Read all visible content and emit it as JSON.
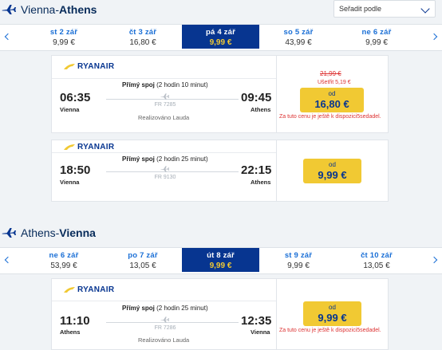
{
  "outbound": {
    "from": "Vienna",
    "separator": " - ",
    "to": "Athens",
    "sort_label": "Seřadit podle",
    "days": [
      {
        "date": "st 2 zář",
        "price": "9,99 €"
      },
      {
        "date": "čt 3 zář",
        "price": "16,80 €"
      },
      {
        "date": "pá 4 zář",
        "price": "9,99 €",
        "selected": true
      },
      {
        "date": "so 5 zář",
        "price": "43,99 €"
      },
      {
        "date": "ne 6 zář",
        "price": "9,99 €"
      }
    ],
    "flights": [
      {
        "airline": "RYANAIR",
        "depart_time": "06:35",
        "depart_city": "Vienna",
        "arrive_time": "09:45",
        "arrive_city": "Athens",
        "direct": "Přímý spoj",
        "duration": "(2 hodin 10 minut)",
        "flight_no": "FR 7285",
        "operated": "Realizováno Lauda",
        "old_price": "21,99 €",
        "saving": "Ušetřit 5,19 €",
        "from_label": "od",
        "price": "16,80 €",
        "seat_note": "Za tuto cenu je ještě k dispozici5sedadel."
      },
      {
        "airline": "RYANAIR",
        "depart_time": "18:50",
        "depart_city": "Vienna",
        "arrive_time": "22:15",
        "arrive_city": "Athens",
        "direct": "Přímý spoj",
        "duration": "(2 hodin 25 minut)",
        "flight_no": "FR 9130",
        "from_label": "od",
        "price": "9,99 €"
      }
    ]
  },
  "return": {
    "from": "Athens",
    "separator": " - ",
    "to": "Vienna",
    "days": [
      {
        "date": "ne 6 zář",
        "price": "53,99 €"
      },
      {
        "date": "po 7 zář",
        "price": "13,05 €"
      },
      {
        "date": "út 8 zář",
        "price": "9,99 €",
        "selected": true
      },
      {
        "date": "st 9 zář",
        "price": "9,99 €"
      },
      {
        "date": "čt 10 zář",
        "price": "13,05 €"
      }
    ],
    "flights": [
      {
        "airline": "RYANAIR",
        "depart_time": "11:10",
        "depart_city": "Athens",
        "arrive_time": "12:35",
        "arrive_city": "Vienna",
        "direct": "Přímý spoj",
        "duration": "(2 hodin 25 minut)",
        "flight_no": "FR 7286",
        "operated": "Realizováno Lauda",
        "from_label": "od",
        "price": "9,99 €",
        "seat_note": "Za tuto cenu je ještě k dispozici5sedadel."
      }
    ]
  },
  "colors": {
    "navy": "#073590",
    "yellow": "#f1c933",
    "link_blue": "#1a6fd6",
    "alert_red": "#dd3333"
  },
  "icons": [
    "plane-icon",
    "ryanair-harp-icon",
    "chevron-left-icon",
    "chevron-right-icon",
    "chevron-down-icon"
  ]
}
